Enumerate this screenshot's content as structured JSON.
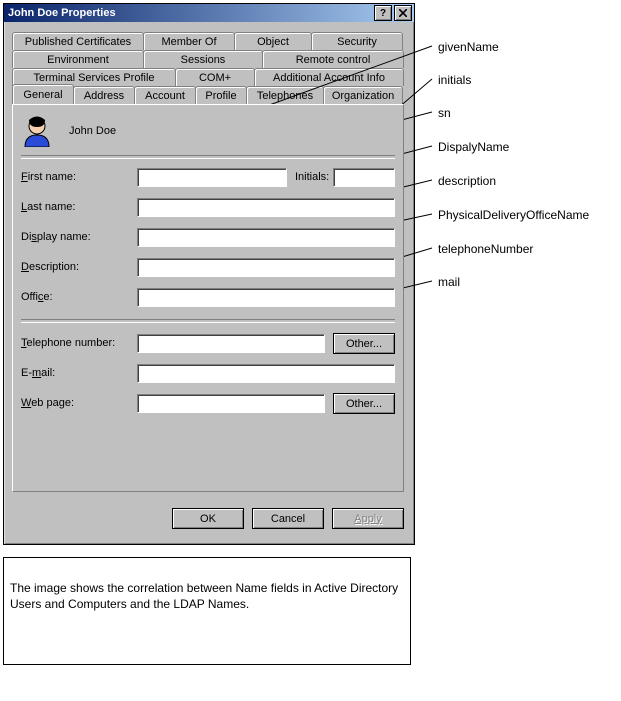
{
  "window": {
    "title": "John Doe Properties"
  },
  "tabs": {
    "row1": [
      "Published Certificates",
      "Member Of",
      "Object",
      "Security"
    ],
    "row2": [
      "Environment",
      "Sessions",
      "Remote control"
    ],
    "row3": [
      "Terminal Services Profile",
      "COM+",
      "Additional Account Info"
    ],
    "row4": [
      "General",
      "Address",
      "Account",
      "Profile",
      "Telephones",
      "Organization"
    ],
    "active": "General"
  },
  "user": {
    "display": "John Doe"
  },
  "fields": {
    "first_name": {
      "label": "First name:",
      "value": ""
    },
    "initials": {
      "label": "Initials:",
      "value": ""
    },
    "last_name": {
      "label": "Last name:",
      "value": ""
    },
    "display": {
      "label": "Display name:",
      "value": ""
    },
    "description": {
      "label": "Description:",
      "value": ""
    },
    "office": {
      "label": "Office:",
      "value": ""
    },
    "telephone": {
      "label": "Telephone number:",
      "value": ""
    },
    "email": {
      "label": "E-mail:",
      "value": ""
    },
    "web": {
      "label": "Web page:",
      "value": ""
    }
  },
  "buttons": {
    "other_tel": "Other...",
    "other_web": "Other...",
    "ok": "OK",
    "cancel": "Cancel",
    "apply": "Apply"
  },
  "annotations": {
    "givenName": "givenName",
    "initials": "initials",
    "sn": "sn",
    "DispalyName": "DispalyName",
    "description": "description",
    "PhysicalDeliveryOfficeName": "PhysicalDeliveryOfficeName",
    "telephoneNumber": "telephoneNumber",
    "mail": "mail"
  },
  "caption": "The image shows the correlation between Name fields in Active Directory Users and Computers and the LDAP Names."
}
